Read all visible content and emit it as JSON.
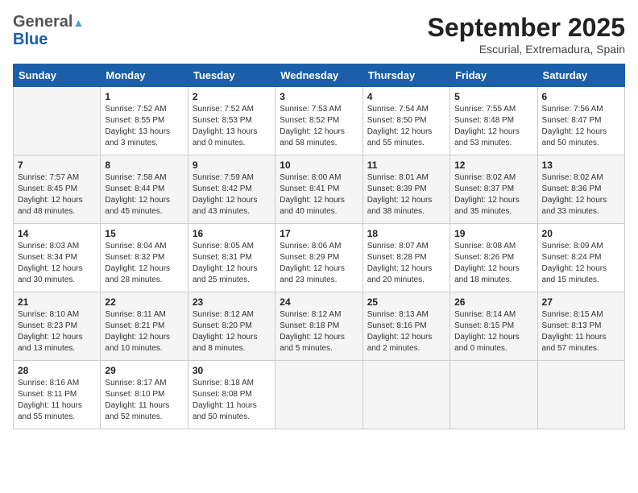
{
  "logo": {
    "general": "General",
    "blue": "Blue"
  },
  "title": "September 2025",
  "subtitle": "Escurial, Extremadura, Spain",
  "days_of_week": [
    "Sunday",
    "Monday",
    "Tuesday",
    "Wednesday",
    "Thursday",
    "Friday",
    "Saturday"
  ],
  "weeks": [
    [
      {
        "day": "",
        "info": ""
      },
      {
        "day": "1",
        "info": "Sunrise: 7:52 AM\nSunset: 8:55 PM\nDaylight: 13 hours\nand 3 minutes."
      },
      {
        "day": "2",
        "info": "Sunrise: 7:52 AM\nSunset: 8:53 PM\nDaylight: 13 hours\nand 0 minutes."
      },
      {
        "day": "3",
        "info": "Sunrise: 7:53 AM\nSunset: 8:52 PM\nDaylight: 12 hours\nand 58 minutes."
      },
      {
        "day": "4",
        "info": "Sunrise: 7:54 AM\nSunset: 8:50 PM\nDaylight: 12 hours\nand 55 minutes."
      },
      {
        "day": "5",
        "info": "Sunrise: 7:55 AM\nSunset: 8:48 PM\nDaylight: 12 hours\nand 53 minutes."
      },
      {
        "day": "6",
        "info": "Sunrise: 7:56 AM\nSunset: 8:47 PM\nDaylight: 12 hours\nand 50 minutes."
      }
    ],
    [
      {
        "day": "7",
        "info": "Sunrise: 7:57 AM\nSunset: 8:45 PM\nDaylight: 12 hours\nand 48 minutes."
      },
      {
        "day": "8",
        "info": "Sunrise: 7:58 AM\nSunset: 8:44 PM\nDaylight: 12 hours\nand 45 minutes."
      },
      {
        "day": "9",
        "info": "Sunrise: 7:59 AM\nSunset: 8:42 PM\nDaylight: 12 hours\nand 43 minutes."
      },
      {
        "day": "10",
        "info": "Sunrise: 8:00 AM\nSunset: 8:41 PM\nDaylight: 12 hours\nand 40 minutes."
      },
      {
        "day": "11",
        "info": "Sunrise: 8:01 AM\nSunset: 8:39 PM\nDaylight: 12 hours\nand 38 minutes."
      },
      {
        "day": "12",
        "info": "Sunrise: 8:02 AM\nSunset: 8:37 PM\nDaylight: 12 hours\nand 35 minutes."
      },
      {
        "day": "13",
        "info": "Sunrise: 8:02 AM\nSunset: 8:36 PM\nDaylight: 12 hours\nand 33 minutes."
      }
    ],
    [
      {
        "day": "14",
        "info": "Sunrise: 8:03 AM\nSunset: 8:34 PM\nDaylight: 12 hours\nand 30 minutes."
      },
      {
        "day": "15",
        "info": "Sunrise: 8:04 AM\nSunset: 8:32 PM\nDaylight: 12 hours\nand 28 minutes."
      },
      {
        "day": "16",
        "info": "Sunrise: 8:05 AM\nSunset: 8:31 PM\nDaylight: 12 hours\nand 25 minutes."
      },
      {
        "day": "17",
        "info": "Sunrise: 8:06 AM\nSunset: 8:29 PM\nDaylight: 12 hours\nand 23 minutes."
      },
      {
        "day": "18",
        "info": "Sunrise: 8:07 AM\nSunset: 8:28 PM\nDaylight: 12 hours\nand 20 minutes."
      },
      {
        "day": "19",
        "info": "Sunrise: 8:08 AM\nSunset: 8:26 PM\nDaylight: 12 hours\nand 18 minutes."
      },
      {
        "day": "20",
        "info": "Sunrise: 8:09 AM\nSunset: 8:24 PM\nDaylight: 12 hours\nand 15 minutes."
      }
    ],
    [
      {
        "day": "21",
        "info": "Sunrise: 8:10 AM\nSunset: 8:23 PM\nDaylight: 12 hours\nand 13 minutes."
      },
      {
        "day": "22",
        "info": "Sunrise: 8:11 AM\nSunset: 8:21 PM\nDaylight: 12 hours\nand 10 minutes."
      },
      {
        "day": "23",
        "info": "Sunrise: 8:12 AM\nSunset: 8:20 PM\nDaylight: 12 hours\nand 8 minutes."
      },
      {
        "day": "24",
        "info": "Sunrise: 8:12 AM\nSunset: 8:18 PM\nDaylight: 12 hours\nand 5 minutes."
      },
      {
        "day": "25",
        "info": "Sunrise: 8:13 AM\nSunset: 8:16 PM\nDaylight: 12 hours\nand 2 minutes."
      },
      {
        "day": "26",
        "info": "Sunrise: 8:14 AM\nSunset: 8:15 PM\nDaylight: 12 hours\nand 0 minutes."
      },
      {
        "day": "27",
        "info": "Sunrise: 8:15 AM\nSunset: 8:13 PM\nDaylight: 11 hours\nand 57 minutes."
      }
    ],
    [
      {
        "day": "28",
        "info": "Sunrise: 8:16 AM\nSunset: 8:11 PM\nDaylight: 11 hours\nand 55 minutes."
      },
      {
        "day": "29",
        "info": "Sunrise: 8:17 AM\nSunset: 8:10 PM\nDaylight: 11 hours\nand 52 minutes."
      },
      {
        "day": "30",
        "info": "Sunrise: 8:18 AM\nSunset: 8:08 PM\nDaylight: 11 hours\nand 50 minutes."
      },
      {
        "day": "",
        "info": ""
      },
      {
        "day": "",
        "info": ""
      },
      {
        "day": "",
        "info": ""
      },
      {
        "day": "",
        "info": ""
      }
    ]
  ]
}
